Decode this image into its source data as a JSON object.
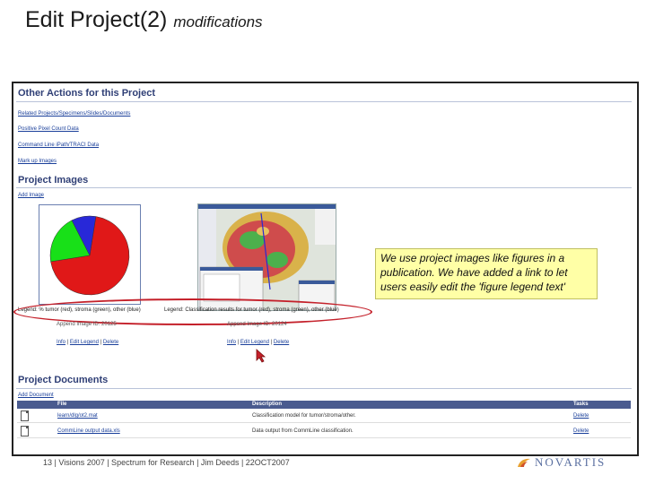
{
  "slide": {
    "title": "Edit Project(2)",
    "subtitle": "modifications",
    "footer": "13 | Visions 2007 | Spectrum for Research | Jim Deeds | 22OCT2007",
    "logo_text": "NOVARTIS"
  },
  "other_actions": {
    "heading": "Other Actions for this Project",
    "links": [
      "Related Projects/Specimens/Slides/Documents",
      "Positive Pixel Count Data",
      "Command Line iPath/TRACI Data",
      "Mark up Images"
    ]
  },
  "project_images": {
    "heading": "Project Images",
    "add_link": "Add Image",
    "images": [
      {
        "legend": "Legend: % tumor (red), stroma (green), other (blue)",
        "caption": "Append Image ID: 20125",
        "actions": [
          "Info",
          "Edit Legend",
          "Delete"
        ]
      },
      {
        "legend": "Legend: Classification results for tumor (red), stroma (green), other (blue)",
        "caption": "Append Image ID: 20124",
        "actions": [
          "Info",
          "Edit Legend",
          "Delete"
        ]
      }
    ],
    "pie": {
      "red_pct": 70,
      "green_pct": 20,
      "blue_pct": 10,
      "colors": [
        "#e01818",
        "#18e018",
        "#2828d8"
      ]
    }
  },
  "project_documents": {
    "heading": "Project Documents",
    "add_link": "Add Document",
    "columns": [
      "File",
      "Description",
      "Tasks"
    ],
    "rows": [
      {
        "file": "learn/dlg/ot2.mat",
        "description": "Classification model for tumor/stroma/other.",
        "task": "Delete"
      },
      {
        "file": "CommLine output data.xls",
        "description": "Data output from CommLine classification.",
        "task": "Delete"
      }
    ]
  },
  "callout": {
    "text": "We use project images like figures in a publication. We have added a link to let users easily edit the 'figure legend text'"
  },
  "colors": {
    "heading": "#2f3f76",
    "link": "#1a3f9a",
    "highlight_oval": "#c4202a",
    "callout_bg": "#ffffa6"
  }
}
